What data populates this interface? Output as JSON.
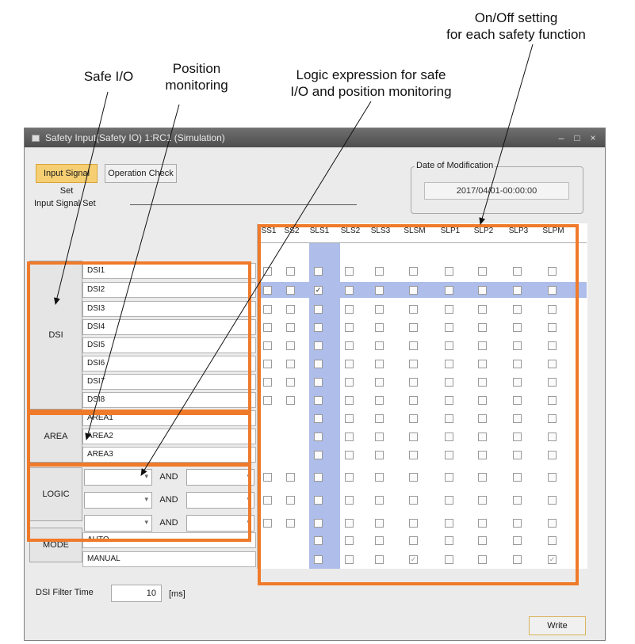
{
  "annotations": {
    "safe_io": "Safe I/O",
    "position_monitoring": "Position\nmonitoring",
    "logic_expression": "Logic expression for safe\nI/O and position monitoring",
    "onoff_setting": "On/Off setting\nfor each safety function"
  },
  "window": {
    "title": "Safety Input(Safety IO) 1:RC1  (Simulation)",
    "controls": [
      "–",
      "□",
      "×"
    ]
  },
  "toolbar": {
    "input_signal_set": "Input Signal Set",
    "operation_check": "Operation Check"
  },
  "section_label": "Input Signal Set",
  "modification": {
    "legend": "Date of Modification",
    "value": "2017/04/01-00:00:00"
  },
  "columns": [
    "SS1",
    "SS2",
    "SLS1",
    "SLS2",
    "SLS3",
    "SLSM",
    "SLP1",
    "SLP2",
    "SLP3",
    "SLPM"
  ],
  "groups": {
    "dsi": {
      "label": "DSI",
      "signals": [
        "DSI1",
        "DSI2",
        "DSI3",
        "DSI4",
        "DSI5",
        "DSI6",
        "DSI7",
        "DSI8"
      ]
    },
    "area": {
      "label": "AREA",
      "signals": [
        "AREA1",
        "AREA2",
        "AREA3"
      ]
    },
    "logic": {
      "label": "LOGIC",
      "operator": [
        "AND",
        "AND",
        "AND"
      ]
    },
    "mode": {
      "label": "MODE",
      "signals": [
        "AUTO",
        "MANUAL"
      ]
    }
  },
  "checked": {
    "dsi2_sls1": true
  },
  "filter": {
    "label": "DSI Filter Time",
    "value": "10",
    "unit": "[ms]"
  },
  "write_button": "Write",
  "colors": {
    "highlight": "#aebde9",
    "annotation_box": "#ef7a2a",
    "active_button": "#f6cf73"
  }
}
